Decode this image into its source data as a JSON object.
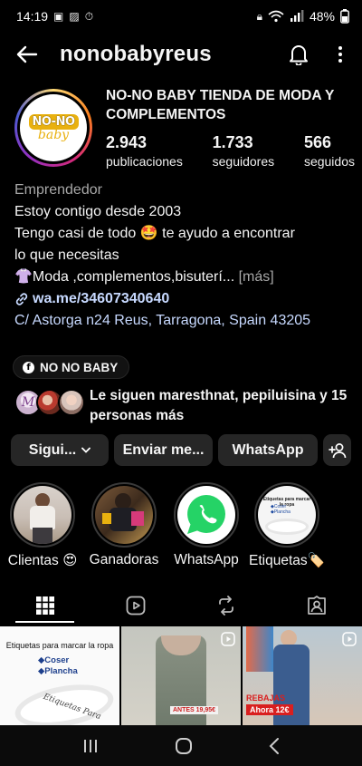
{
  "status_bar": {
    "time": "14:19",
    "battery": "48%"
  },
  "header": {
    "username": "nonobabyreus",
    "back_icon": "arrow-left-icon",
    "notification_icon": "bell-icon",
    "more_icon": "more-vertical-icon"
  },
  "profile": {
    "avatar_logo_top": "NO-NO",
    "avatar_logo_bottom": "baby",
    "display_name": "NO-NO BABY TIENDA DE MODA Y COMPLEMENTOS",
    "stats": [
      {
        "value": "2.943",
        "label": "publicaciones"
      },
      {
        "value": "1.733",
        "label": "seguidores"
      },
      {
        "value": "566",
        "label": "seguidos"
      }
    ],
    "category": "Emprendedor",
    "bio_line1": "Estoy contigo desde 2003",
    "bio_line2a": "Tengo casi de todo ",
    "bio_line2_emoji": "🤩",
    "bio_line2b": " te ayudo a encontrar",
    "bio_line3": "lo que necesitas",
    "bio_line4_emoji": "👚",
    "bio_line4": "Moda ,complementos,bisuterí...",
    "more_label": "[más]",
    "link": "wa.me/34607340640",
    "address": "C/ Astorga n24 Reus, Tarragona, Spain 43205",
    "facebook_page": "NO NO BABY",
    "followed_by": "Le siguen maresthnat, pepiluisina y 15 personas más"
  },
  "actions": {
    "following": "Sigui...",
    "message": "Enviar me...",
    "whatsapp": "WhatsApp"
  },
  "highlights": [
    {
      "label": "Clientas 😍"
    },
    {
      "label": "Ganadoras"
    },
    {
      "label": "WhatsApp"
    },
    {
      "label": "Etiquetas🏷️"
    }
  ],
  "highlight_etiquetas_text": {
    "title": "Etiquetas para marcar la ropa",
    "item1": "◆Coser",
    "item2": "◆Plancha"
  },
  "grid": {
    "post1": {
      "title": "Etiquetas para marcar la ropa",
      "item1": "◆Coser",
      "item2": "◆Plancha",
      "tag_text": "Etiquetas Para"
    },
    "post2": {
      "price_tag": "ANTES 19,95€"
    },
    "post3": {
      "sale_title": "REBAJAS",
      "sale_price": "Ahora 12€"
    }
  },
  "colors": {
    "background": "#000000",
    "button_bg": "#262626",
    "link": "#c7d9ff",
    "secondary_text": "#a8a8a8"
  }
}
